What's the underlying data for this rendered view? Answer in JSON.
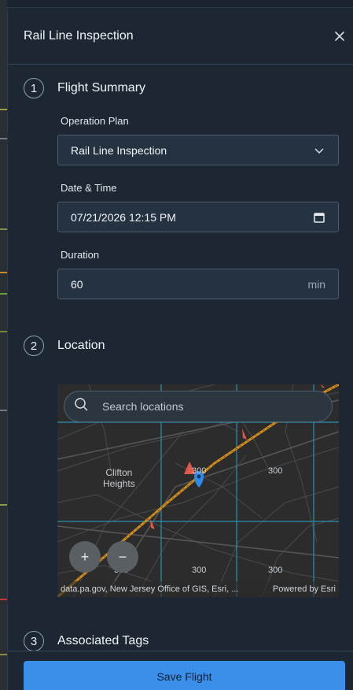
{
  "panel": {
    "title": "Rail Line Inspection"
  },
  "steps": [
    {
      "number": "1",
      "title": "Flight Summary"
    },
    {
      "number": "2",
      "title": "Location"
    },
    {
      "number": "3",
      "title": "Associated Tags"
    }
  ],
  "flight_summary": {
    "operation_plan_label": "Operation Plan",
    "operation_plan_value": "Rail Line Inspection",
    "datetime_label": "Date & Time",
    "datetime_value": "07/21/2026 12:15 PM",
    "duration_label": "Duration",
    "duration_value": "60",
    "duration_unit": "min"
  },
  "location": {
    "search_placeholder": "Search locations",
    "place_label_line1": "Clifton",
    "place_label_line2": "Heights",
    "grid_labels": [
      "300",
      "300",
      "300",
      "300",
      "300"
    ],
    "zoom_in": "+",
    "zoom_out": "−",
    "attribution_left": "data.pa.gov, New Jersey Office of GIS, Esri, ...",
    "attribution_right": "Powered by Esri"
  },
  "footer": {
    "save_label": "Save Flight"
  },
  "colors": {
    "accent": "#3a8fe8",
    "rail_line": "#d4901e",
    "pin": "#2f8ae8",
    "marker": "#e05a4a"
  }
}
